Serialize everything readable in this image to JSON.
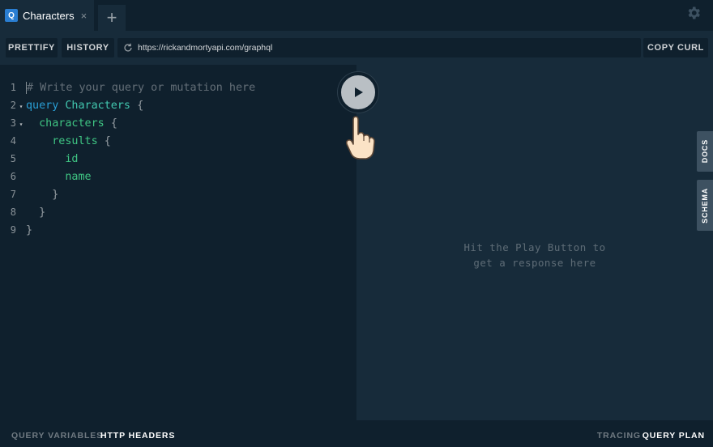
{
  "tabs": [
    {
      "badge": "Q",
      "title": "Characters",
      "close": "×"
    }
  ],
  "new_tab": "+",
  "toolbar": {
    "prettify": "PRETTIFY",
    "history": "HISTORY",
    "endpoint": "https://rickandmortyapi.com/graphql",
    "copy_curl": "COPY CURL"
  },
  "editor": {
    "line_numbers": [
      "1",
      "2",
      "3",
      "4",
      "5",
      "6",
      "7",
      "8",
      "9"
    ],
    "fold_marker": "▾",
    "comment": "# Write your query or mutation here",
    "keyword": "query",
    "operation_name": "Characters",
    "field_characters": "characters",
    "field_results": "results",
    "field_id": "id",
    "field_name": "name",
    "open_brace": "{",
    "close_brace": "}"
  },
  "result": {
    "placeholder_line1": "Hit the Play Button to",
    "placeholder_line2": "get a response here"
  },
  "side_tabs": {
    "docs": "DOCS",
    "schema": "SCHEMA"
  },
  "bottom": {
    "query_variables": "QUERY VARIABLES",
    "http_headers": "HTTP HEADERS",
    "tracing": "TRACING",
    "query_plan": "QUERY PLAN"
  },
  "colors": {
    "background": "#172b3a",
    "editor_bg": "#0f202d",
    "keyword": "#2a9fd6",
    "field": "#3fc583",
    "badge": "#2a7ed2"
  },
  "icons": {
    "settings": "gear-icon",
    "reload": "reload-icon",
    "play": "play-icon",
    "pointer": "pointing-hand-icon"
  }
}
